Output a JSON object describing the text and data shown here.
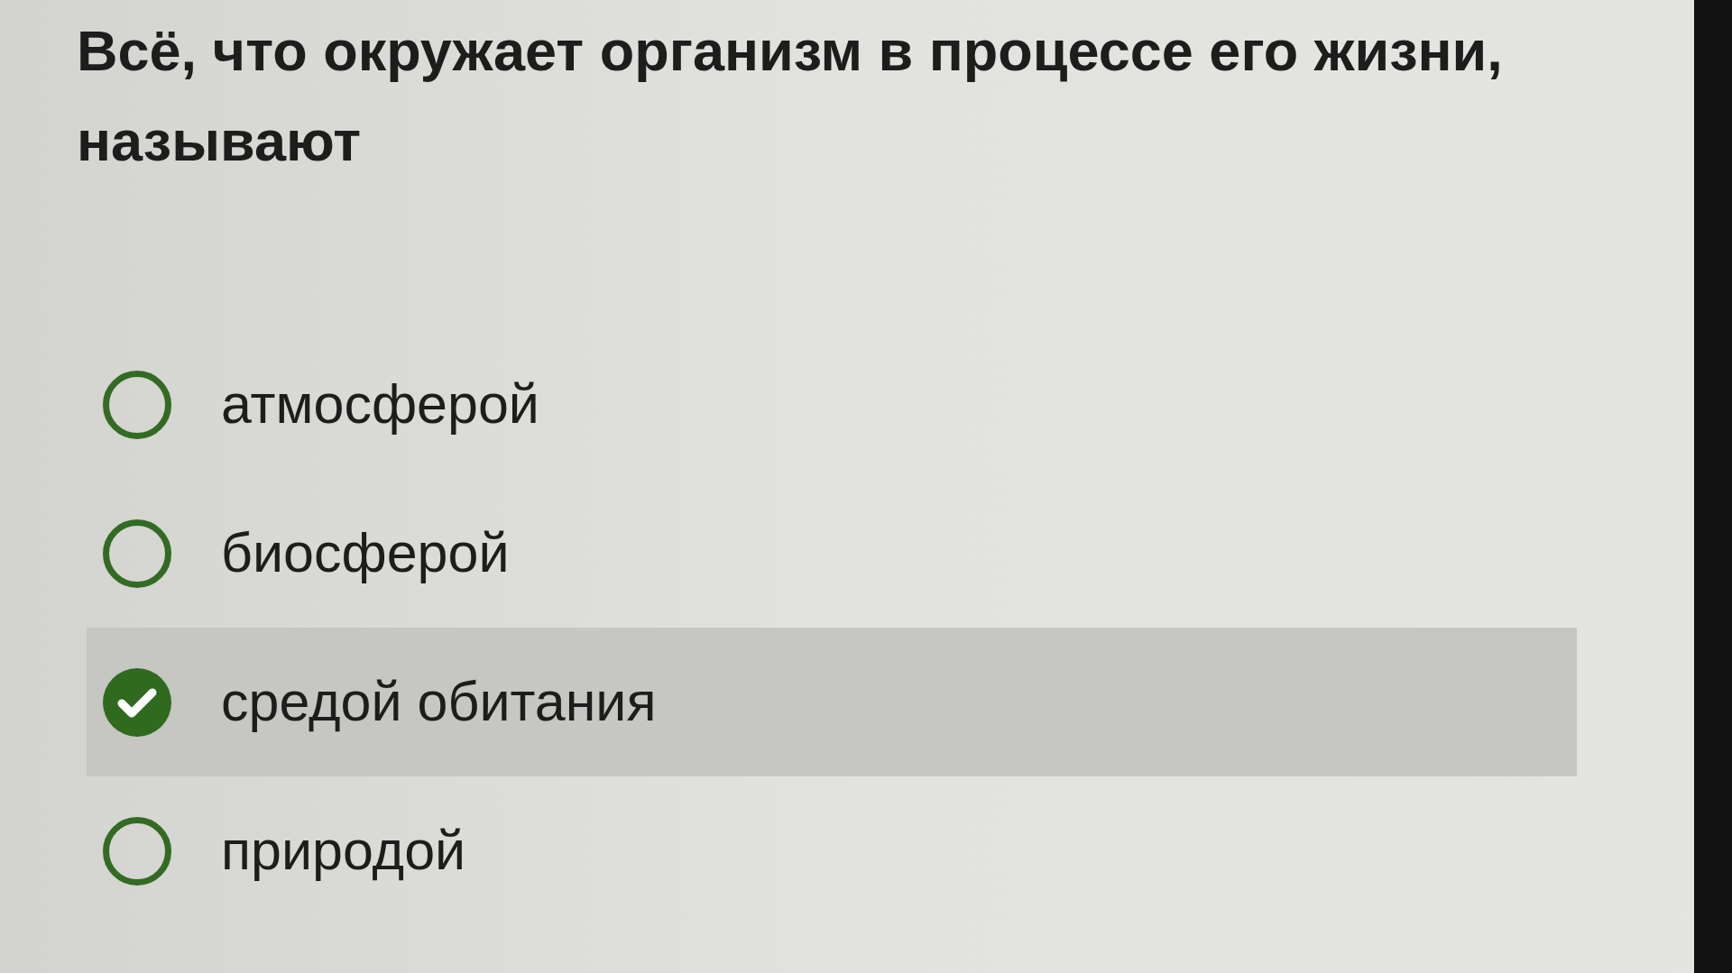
{
  "question": "Всё, что окружает организм в процессе его жизни, называют",
  "options": [
    {
      "label": "атмосферой",
      "selected": false
    },
    {
      "label": "биосферой",
      "selected": false
    },
    {
      "label": "средой обитания",
      "selected": true
    },
    {
      "label": "природой",
      "selected": false
    }
  ]
}
